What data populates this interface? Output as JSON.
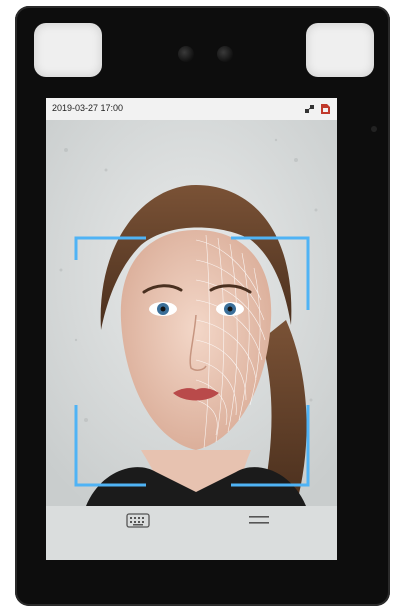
{
  "status_bar": {
    "datetime": "2019-03-27  17:00",
    "icons": [
      "network-icon",
      "sim-card-icon"
    ]
  },
  "camera_view": {
    "subject": "face",
    "frame_color": "#4fb3f5",
    "mesh_color": "#ffffff"
  },
  "bottom_bar": {
    "icons": [
      "keyboard-icon",
      "menu-icon"
    ]
  },
  "colors": {
    "device_body": "#0d0d0d",
    "ir_light": "#efefef",
    "screen_bg": "#d9dbdb",
    "status_bar_bg": "#f2f2f2",
    "accent": "#4fb3f5"
  }
}
